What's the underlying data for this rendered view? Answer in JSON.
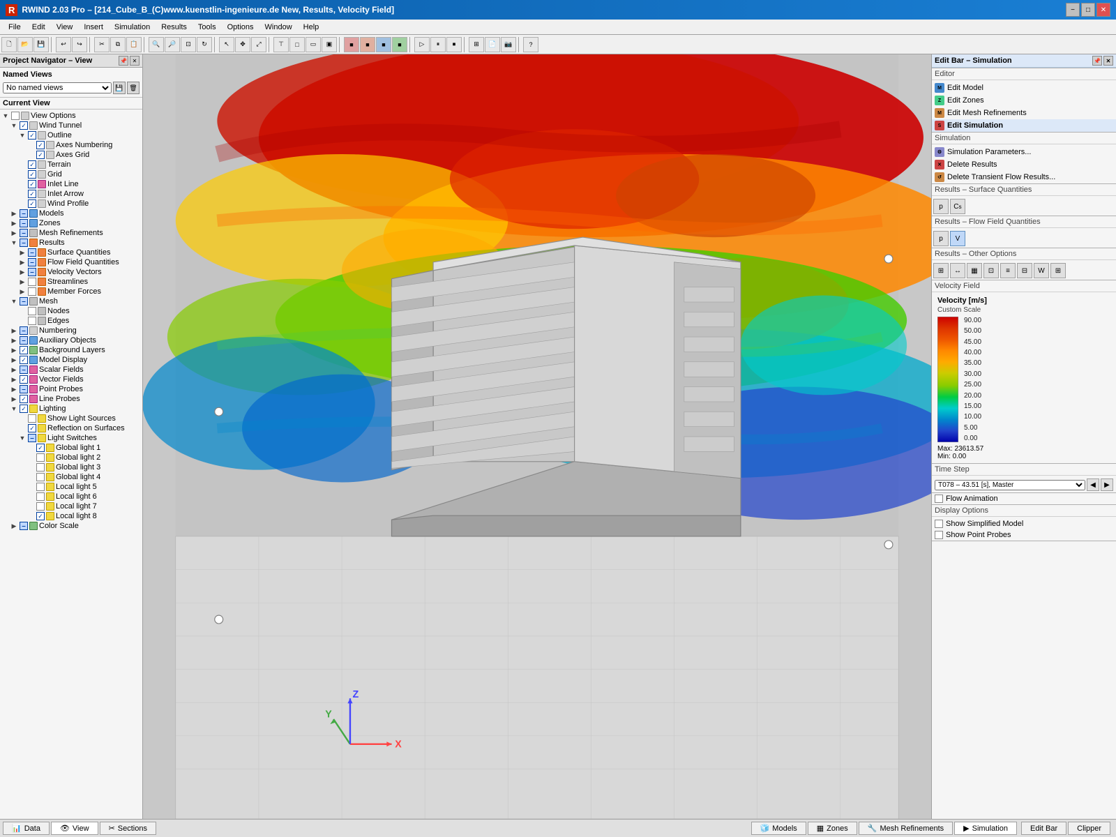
{
  "titlebar": {
    "title": "RWIND 2.03 Pro – [214_Cube_B_(C)www.kuenstlin-ingenieure.de New, Results, Velocity Field]",
    "minimize": "−",
    "restore": "□",
    "close": "✕",
    "app_icon": "R"
  },
  "menubar": {
    "items": [
      "File",
      "Edit",
      "View",
      "Insert",
      "Simulation",
      "Results",
      "Tools",
      "Options",
      "Window",
      "Help"
    ]
  },
  "left_panel": {
    "title": "Project Navigator – View",
    "named_views_label": "Named Views",
    "named_views_placeholder": "No named views",
    "current_view_label": "Current View",
    "tree": [
      {
        "level": 0,
        "label": "View Options",
        "expand": "down",
        "checked": "none"
      },
      {
        "level": 1,
        "label": "Wind Tunnel",
        "expand": "down",
        "checked": "check"
      },
      {
        "level": 2,
        "label": "Outline",
        "expand": "down",
        "checked": "check"
      },
      {
        "level": 3,
        "label": "Axes Numbering",
        "expand": "none",
        "checked": "check"
      },
      {
        "level": 3,
        "label": "Axes Grid",
        "expand": "none",
        "checked": "check"
      },
      {
        "level": 2,
        "label": "Terrain",
        "expand": "none",
        "checked": "check"
      },
      {
        "level": 2,
        "label": "Grid",
        "expand": "none",
        "checked": "check"
      },
      {
        "level": 2,
        "label": "Inlet Line",
        "expand": "none",
        "checked": "check"
      },
      {
        "level": 2,
        "label": "Inlet Arrow",
        "expand": "none",
        "checked": "check"
      },
      {
        "level": 2,
        "label": "Wind Profile",
        "expand": "none",
        "checked": "check"
      },
      {
        "level": 1,
        "label": "Models",
        "expand": "right",
        "checked": "partial"
      },
      {
        "level": 1,
        "label": "Zones",
        "expand": "right",
        "checked": "partial"
      },
      {
        "level": 1,
        "label": "Mesh Refinements",
        "expand": "right",
        "checked": "partial"
      },
      {
        "level": 1,
        "label": "Results",
        "expand": "down",
        "checked": "partial"
      },
      {
        "level": 2,
        "label": "Surface Quantities",
        "expand": "right",
        "checked": "partial"
      },
      {
        "level": 2,
        "label": "Flow Field Quantities",
        "expand": "right",
        "checked": "partial"
      },
      {
        "level": 2,
        "label": "Velocity Vectors",
        "expand": "right",
        "checked": "partial"
      },
      {
        "level": 2,
        "label": "Streamlines",
        "expand": "right",
        "checked": "none"
      },
      {
        "level": 2,
        "label": "Member Forces",
        "expand": "right",
        "checked": "none"
      },
      {
        "level": 1,
        "label": "Mesh",
        "expand": "down",
        "checked": "partial"
      },
      {
        "level": 2,
        "label": "Nodes",
        "expand": "none",
        "checked": "none"
      },
      {
        "level": 2,
        "label": "Edges",
        "expand": "none",
        "checked": "none"
      },
      {
        "level": 1,
        "label": "Numbering",
        "expand": "right",
        "checked": "partial"
      },
      {
        "level": 1,
        "label": "Auxiliary Objects",
        "expand": "right",
        "checked": "partial"
      },
      {
        "level": 1,
        "label": "Background Layers",
        "expand": "right",
        "checked": "check"
      },
      {
        "level": 1,
        "label": "Model Display",
        "expand": "right",
        "checked": "check"
      },
      {
        "level": 1,
        "label": "Scalar Fields",
        "expand": "right",
        "checked": "partial"
      },
      {
        "level": 1,
        "label": "Vector Fields",
        "expand": "right",
        "checked": "check"
      },
      {
        "level": 1,
        "label": "Point Probes",
        "expand": "right",
        "checked": "partial"
      },
      {
        "level": 1,
        "label": "Line Probes",
        "expand": "right",
        "checked": "check"
      },
      {
        "level": 1,
        "label": "Lighting",
        "expand": "down",
        "checked": "check"
      },
      {
        "level": 2,
        "label": "Show Light Sources",
        "expand": "none",
        "checked": "none"
      },
      {
        "level": 2,
        "label": "Reflection on Surfaces",
        "expand": "none",
        "checked": "check"
      },
      {
        "level": 2,
        "label": "Light Switches",
        "expand": "down",
        "checked": "partial"
      },
      {
        "level": 3,
        "label": "Global light 1",
        "expand": "none",
        "checked": "check"
      },
      {
        "level": 3,
        "label": "Global light 2",
        "expand": "none",
        "checked": "none"
      },
      {
        "level": 3,
        "label": "Global light 3",
        "expand": "none",
        "checked": "none"
      },
      {
        "level": 3,
        "label": "Global light 4",
        "expand": "none",
        "checked": "none"
      },
      {
        "level": 3,
        "label": "Local light 5",
        "expand": "none",
        "checked": "none"
      },
      {
        "level": 3,
        "label": "Local light 6",
        "expand": "none",
        "checked": "none"
      },
      {
        "level": 3,
        "label": "Local light 7",
        "expand": "none",
        "checked": "none"
      },
      {
        "level": 3,
        "label": "Local light 8",
        "expand": "none",
        "checked": "check"
      },
      {
        "level": 1,
        "label": "Color Scale",
        "expand": "right",
        "checked": "partial"
      }
    ]
  },
  "right_panel": {
    "title": "Edit Bar – Simulation",
    "editor_label": "Editor",
    "editor_links": [
      "Edit Model",
      "Edit Zones",
      "Edit Mesh Refinements",
      "Edit Simulation"
    ],
    "simulation_label": "Simulation",
    "simulation_links": [
      "Simulation Parameters...",
      "Delete Results",
      "Delete Transient Flow Results..."
    ],
    "surface_label": "Results – Surface Quantities",
    "surface_btns": [
      "p",
      "Cs"
    ],
    "flowfield_label": "Results – Flow Field Quantities",
    "flowfield_btns_active": [
      "p",
      "V"
    ],
    "other_label": "Results – Other Options",
    "other_btns": [
      "⊞",
      "↔",
      "▦",
      "⊡",
      "⊞",
      "≡",
      "⊡",
      "⊞"
    ],
    "velocity_label": "Velocity Field",
    "velocity_unit": "Velocity [m/s]",
    "velocity_scale_type": "Custom Scale",
    "legend": {
      "values": [
        90.0,
        50.0,
        45.0,
        40.0,
        35.0,
        30.0,
        25.0,
        20.0,
        15.0,
        10.0,
        5.0,
        0.0
      ],
      "colors": [
        "#cc0000",
        "#dd2200",
        "#ee4400",
        "#ff6600",
        "#ff8800",
        "#ffaa00",
        "#88cc00",
        "#00cc00",
        "#00aaaa",
        "#0088cc",
        "#2244cc",
        "#0000aa"
      ]
    },
    "legend_max_label": "Max:",
    "legend_max_value": "23613.57",
    "legend_min_label": "Min:",
    "legend_min_value": "0.00",
    "timestep_label": "Time Step",
    "timestep_value": "T078 – 43.51 [s], Master",
    "flow_animation_label": "Flow Animation",
    "display_options_label": "Display Options",
    "show_simplified_label": "Show Simplified Model",
    "show_point_probes_label": "Show Point Probes"
  },
  "bottom_left_tabs": [
    {
      "label": "Data",
      "icon": "📊"
    },
    {
      "label": "View",
      "icon": "👁"
    },
    {
      "label": "Sections",
      "icon": "✂"
    }
  ],
  "bottom_right_tabs": [
    {
      "label": "Models",
      "icon": "🧊"
    },
    {
      "label": "Zones",
      "icon": "▦"
    },
    {
      "label": "Mesh Refinements",
      "icon": "🔧"
    },
    {
      "label": "Simulation",
      "icon": "▶",
      "active": true
    }
  ],
  "bottom_right_btns": [
    "Edit Bar",
    "Clipper"
  ]
}
